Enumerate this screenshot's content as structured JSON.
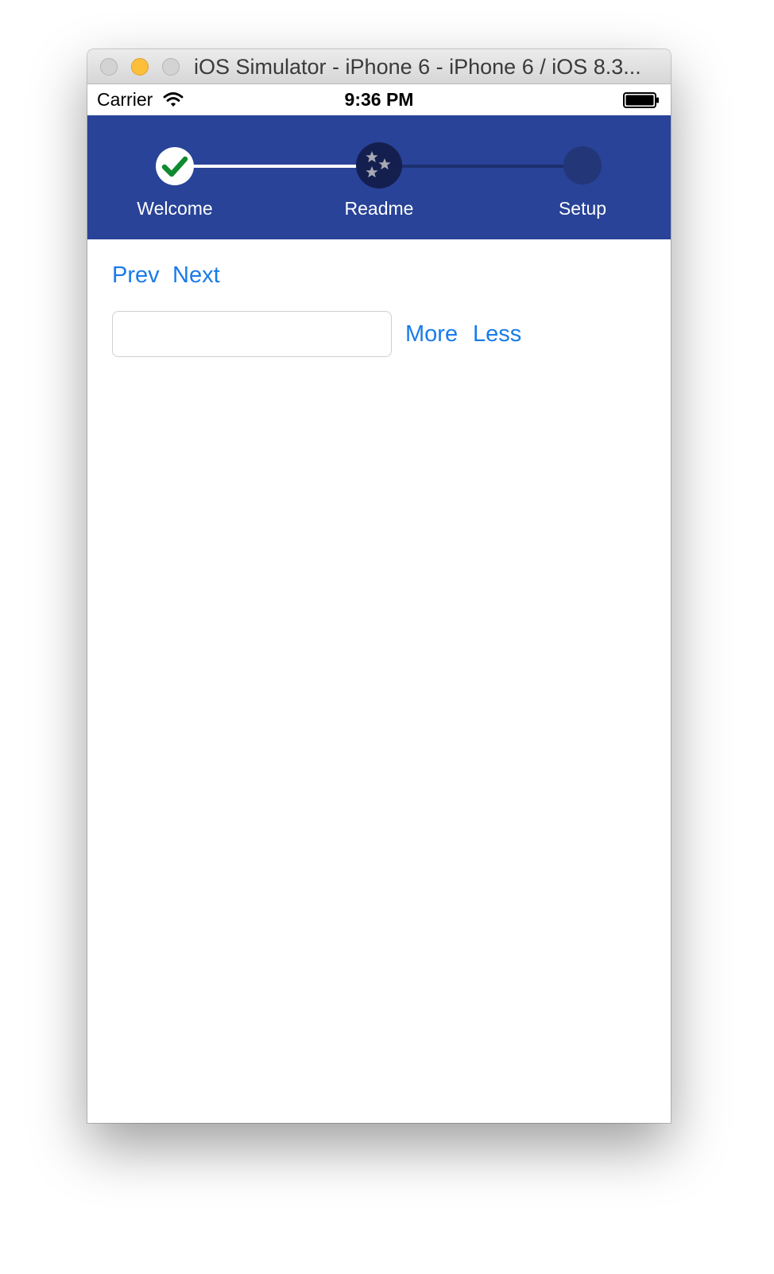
{
  "window": {
    "title": "iOS Simulator - iPhone 6 - iPhone 6 / iOS 8.3..."
  },
  "statusbar": {
    "carrier": "Carrier",
    "time": "9:36 PM",
    "wifi_icon": "wifi-icon",
    "battery_icon": "battery-icon"
  },
  "stepper": {
    "steps": [
      {
        "label": "Welcome",
        "state": "completed",
        "icon": "checkmark-icon"
      },
      {
        "label": "Readme",
        "state": "current",
        "icon": "stars-icon"
      },
      {
        "label": "Setup",
        "state": "pending",
        "icon": ""
      }
    ],
    "colors": {
      "background": "#284397",
      "check": "#0f8a2f",
      "current": "#141f4f",
      "pending": "#223678"
    }
  },
  "nav": {
    "prev_label": "Prev",
    "next_label": "Next"
  },
  "input": {
    "value": "",
    "more_label": "More",
    "less_label": "Less"
  },
  "colors": {
    "link": "#1a7be8"
  }
}
